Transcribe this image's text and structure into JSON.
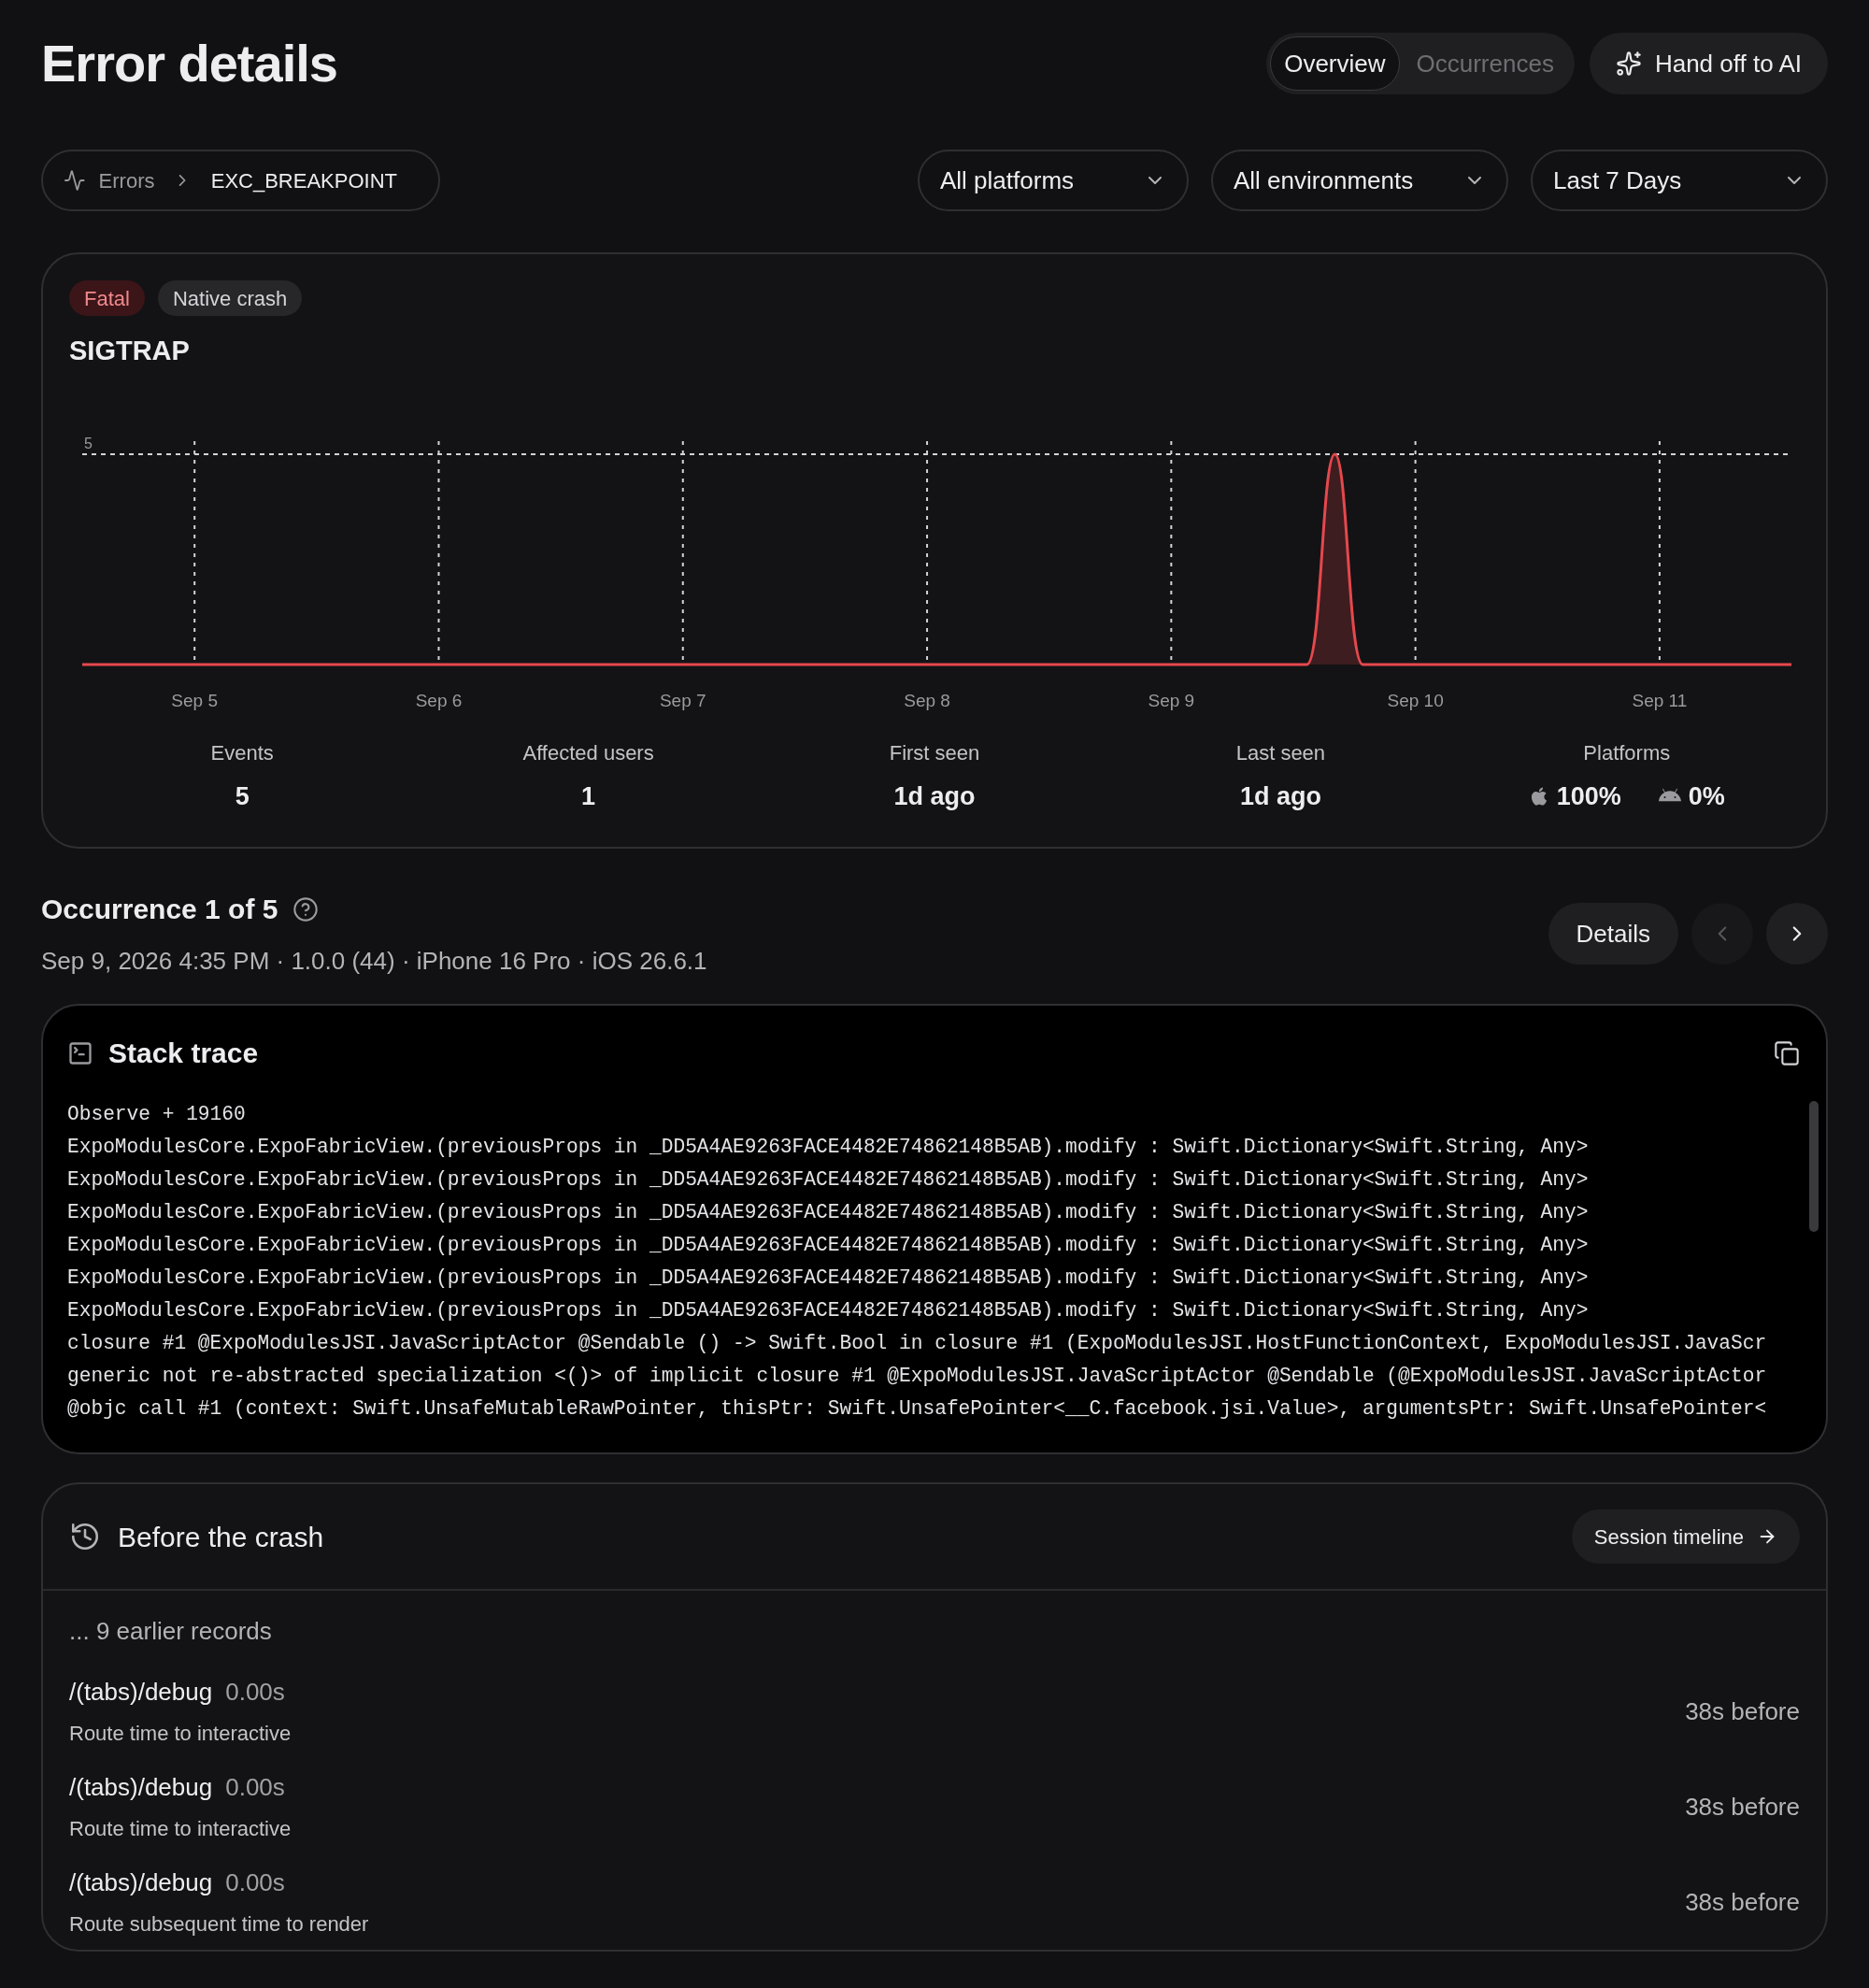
{
  "header": {
    "title": "Error details",
    "tabs": [
      {
        "label": "Overview",
        "selected": true
      },
      {
        "label": "Occurrences",
        "selected": false
      }
    ],
    "ai_button": "Hand off to AI"
  },
  "breadcrumb": [
    "Errors",
    "EXC_BREAKPOINT"
  ],
  "filters": [
    "All platforms",
    "All environments",
    "Last 7 Days"
  ],
  "issue": {
    "tags": [
      {
        "label": "Fatal",
        "kind": "fatal"
      },
      {
        "label": "Native crash",
        "kind": "neutral"
      }
    ],
    "title": "SIGTRAP",
    "chart": {
      "y_label": "5",
      "x_labels": [
        "Sep 5",
        "Sep 6",
        "Sep 7",
        "Sep 8",
        "Sep 9",
        "Sep 10",
        "Sep 11"
      ]
    },
    "stats": [
      {
        "label": "Events",
        "value": "5"
      },
      {
        "label": "Affected users",
        "value": "1"
      },
      {
        "label": "First seen",
        "value": "1d ago"
      },
      {
        "label": "Last seen",
        "value": "1d ago"
      }
    ],
    "platforms": {
      "label": "Platforms",
      "items": [
        {
          "kind": "apple",
          "value": "100%"
        },
        {
          "kind": "android",
          "value": "0%"
        }
      ]
    }
  },
  "occurrence": {
    "title": "Occurrence 1 of 5",
    "meta": "Sep 9, 2026 4:35 PM · 1.0.0 (44) · iPhone 16 Pro · iOS 26.6.1",
    "details_button": "Details",
    "prev": {
      "disabled": true
    },
    "next": {
      "disabled": false
    }
  },
  "stack_trace": {
    "title": "Stack trace",
    "lines": [
      "Observe + 19160",
      "ExpoModulesCore.ExpoFabricView.(previousProps in _DD5A4AE9263FACE4482E74862148B5AB).modify : Swift.Dictionary<Swift.String, Any>",
      "ExpoModulesCore.ExpoFabricView.(previousProps in _DD5A4AE9263FACE4482E74862148B5AB).modify : Swift.Dictionary<Swift.String, Any>",
      "ExpoModulesCore.ExpoFabricView.(previousProps in _DD5A4AE9263FACE4482E74862148B5AB).modify : Swift.Dictionary<Swift.String, Any>",
      "ExpoModulesCore.ExpoFabricView.(previousProps in _DD5A4AE9263FACE4482E74862148B5AB).modify : Swift.Dictionary<Swift.String, Any>",
      "ExpoModulesCore.ExpoFabricView.(previousProps in _DD5A4AE9263FACE4482E74862148B5AB).modify : Swift.Dictionary<Swift.String, Any>",
      "ExpoModulesCore.ExpoFabricView.(previousProps in _DD5A4AE9263FACE4482E74862148B5AB).modify : Swift.Dictionary<Swift.String, Any>",
      "closure #1 @ExpoModulesJSI.JavaScriptActor @Sendable () -> Swift.Bool in closure #1 (ExpoModulesJSI.HostFunctionContext, ExpoModulesJSI.JavaScr",
      "generic not re-abstracted specialization <()> of implicit closure #1 @ExpoModulesJSI.JavaScriptActor @Sendable (@ExpoModulesJSI.JavaScriptActor",
      "@objc call #1 (context: Swift.UnsafeMutableRawPointer, thisPtr: Swift.UnsafePointer<__C.facebook.jsi.Value>, argumentsPtr: Swift.UnsafePointer<"
    ]
  },
  "before_crash": {
    "title": "Before the crash",
    "button": "Session timeline",
    "earlier": "... 9 earlier records",
    "records": [
      {
        "route": "/(tabs)/debug",
        "duration": "0.00s",
        "description": "Route time to interactive",
        "when": "38s before"
      },
      {
        "route": "/(tabs)/debug",
        "duration": "0.00s",
        "description": "Route time to interactive",
        "when": "38s before"
      },
      {
        "route": "/(tabs)/debug",
        "duration": "0.00s",
        "description": "Route subsequent time to render",
        "when": "38s before"
      }
    ]
  }
}
